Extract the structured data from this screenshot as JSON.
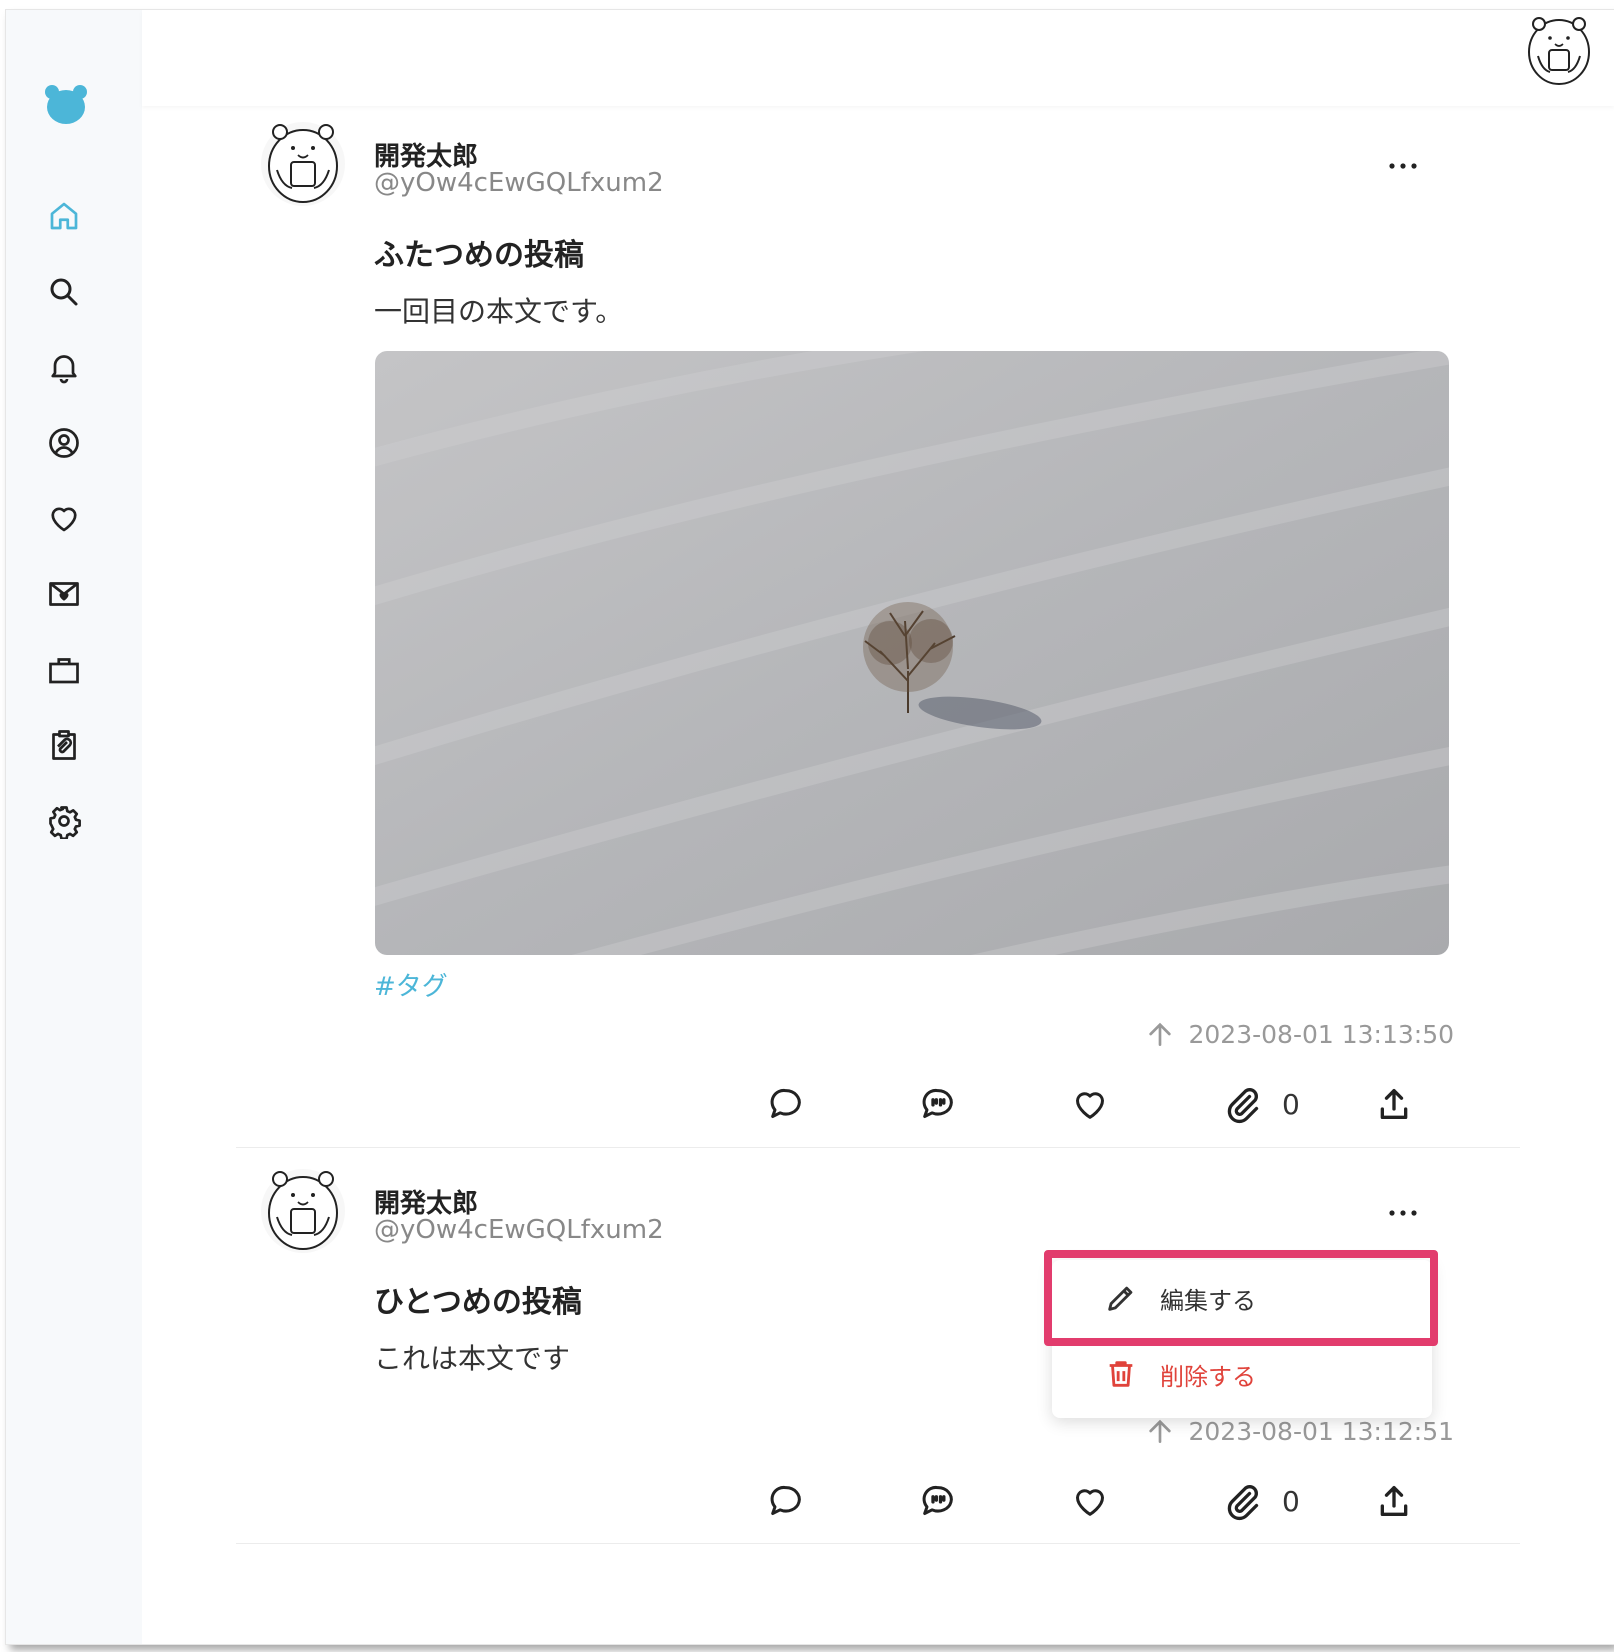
{
  "app": {
    "logo_icon": "bear-logo-icon",
    "accent_color": "#4cb6d8",
    "highlight_color": "#e23c6d"
  },
  "sidebar": {
    "items": [
      {
        "name": "home",
        "icon": "home-icon",
        "active": true
      },
      {
        "name": "search",
        "icon": "search-icon"
      },
      {
        "name": "notifications",
        "icon": "bell-icon"
      },
      {
        "name": "profile",
        "icon": "user-circle-icon"
      },
      {
        "name": "likes",
        "icon": "heart-icon"
      },
      {
        "name": "messages",
        "icon": "mail-heart-icon"
      },
      {
        "name": "jobs",
        "icon": "briefcase-icon"
      },
      {
        "name": "clipboard",
        "icon": "clipboard-clip-icon"
      },
      {
        "name": "settings",
        "icon": "gear-icon"
      }
    ]
  },
  "posts": [
    {
      "author_name": "開発太郎",
      "author_handle": "@yOw4cEwGQLfxum2",
      "title": "ふたつめの投稿",
      "body": "一回目の本文です。",
      "tag": "#タグ",
      "timestamp": "2023-08-01 13:13:50",
      "clip_count": "0",
      "has_image": true
    },
    {
      "author_name": "開発太郎",
      "author_handle": "@yOw4cEwGQLfxum2",
      "title": "ひとつめの投稿",
      "body": "これは本文です",
      "timestamp": "2023-08-01 13:12:51",
      "clip_count": "0",
      "has_image": false
    }
  ],
  "context_menu": {
    "edit_label": "編集する",
    "delete_label": "削除する",
    "delete_color": "#e0433b"
  }
}
